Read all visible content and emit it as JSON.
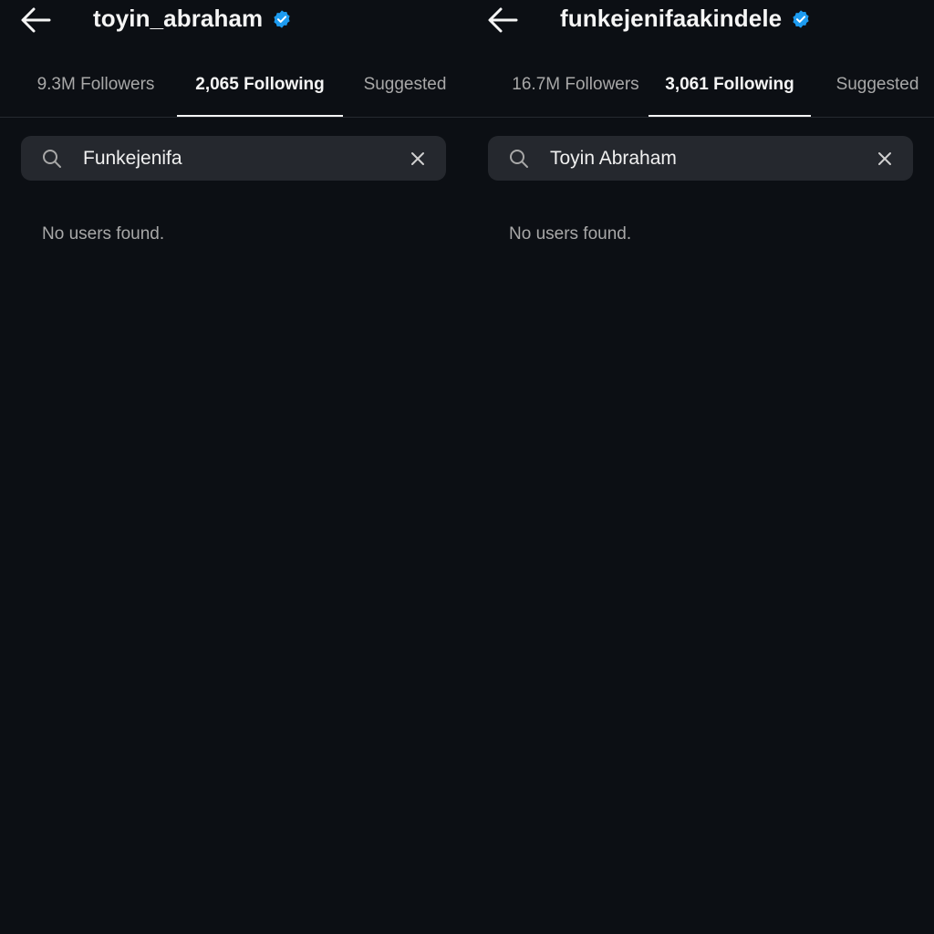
{
  "colors": {
    "background": "#0c0f14",
    "search_background": "#25282e",
    "verified_badge": "#1d9bf0",
    "text_primary": "#f5f5f5",
    "text_secondary": "#a8a8a8"
  },
  "panels": [
    {
      "username": "toyin_abraham",
      "verified": true,
      "tabs": [
        {
          "label": "9.3M Followers",
          "active": false
        },
        {
          "label": "2,065 Following",
          "active": true
        },
        {
          "label": "Suggested",
          "active": false
        }
      ],
      "search": {
        "value": "Funkejenifa",
        "icon": "search-icon",
        "clear_icon": "close-icon"
      },
      "empty_message": "No users found."
    },
    {
      "username": "funkejenifaakindele",
      "verified": true,
      "tabs": [
        {
          "label": "16.7M Followers",
          "active": false
        },
        {
          "label": "3,061 Following",
          "active": true
        },
        {
          "label": "Suggested",
          "active": false
        }
      ],
      "search": {
        "value": "Toyin Abraham",
        "icon": "search-icon",
        "clear_icon": "close-icon"
      },
      "empty_message": "No users found."
    }
  ]
}
